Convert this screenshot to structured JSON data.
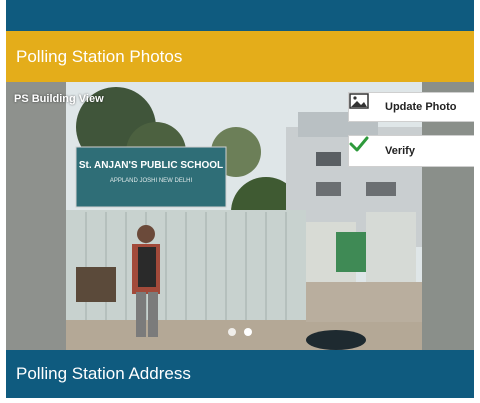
{
  "header": {
    "section_title": "Polling Station Photos"
  },
  "photo": {
    "caption": "PS Building View",
    "sign_text_line1": "St. ANJAN'S PUBLIC SCHOOL",
    "sign_text_line2": "APPLAND JOSHI NEW DELHI",
    "carousel_count": 2,
    "carousel_active": 2
  },
  "actions": {
    "update_photo_label": "Update Photo",
    "verify_label": "Verify"
  },
  "footer": {
    "address_title": "Polling Station Address"
  },
  "colors": {
    "top_bar": "#0f5b7f",
    "section_header": "#e4ad1a",
    "verify_check": "#2e9a3c"
  }
}
